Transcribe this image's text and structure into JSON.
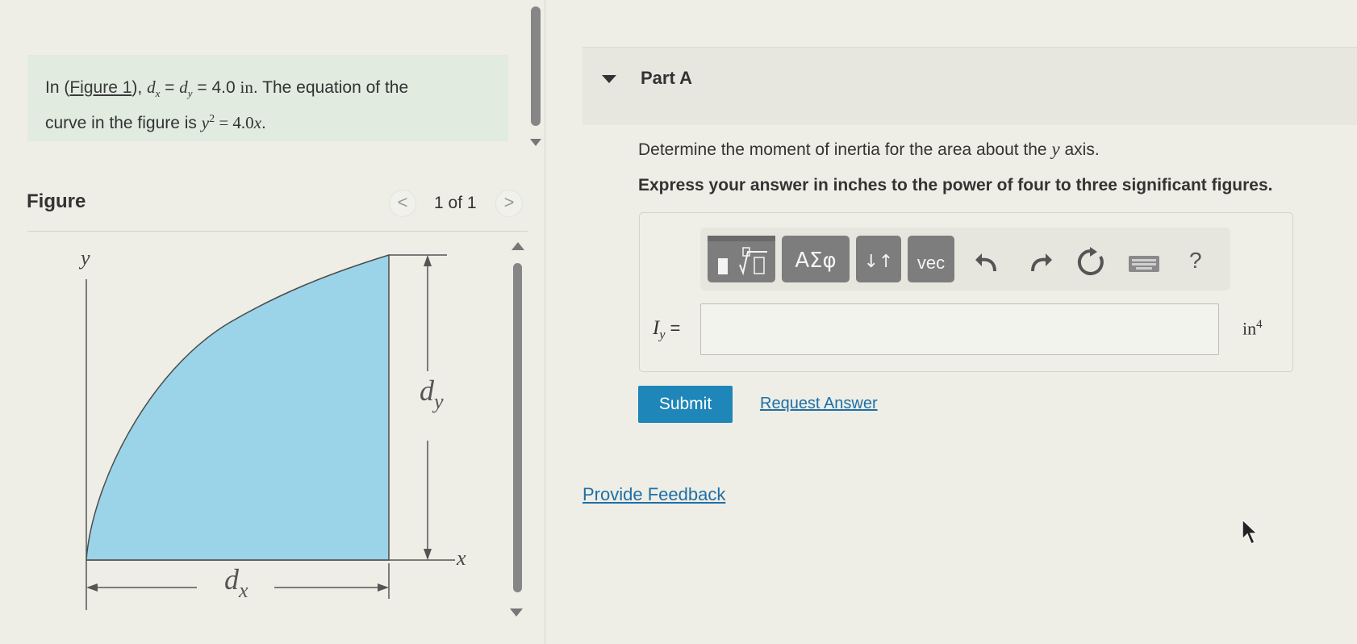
{
  "problem": {
    "prefix": "In (",
    "figure_link": "Figure 1",
    "after_link": "), ",
    "dx_sym": "d",
    "dx_sub": "x",
    "eq1": " = ",
    "dy_sym": "d",
    "dy_sub": "y",
    "eq2": " = 4.0 ",
    "unit": "in",
    "rest1": ". The equation of the",
    "line2_text": "curve in the figure is ",
    "curve_y": "y",
    "curve_exp": "2",
    "curve_eq": " = 4.0",
    "curve_x": "x",
    "curve_end": "."
  },
  "figure": {
    "title": "Figure",
    "counter": "1 of 1",
    "prev_glyph": "<",
    "next_glyph": ">",
    "labels": {
      "y_axis": "y",
      "x_axis": "x",
      "dy": "d",
      "dy_sub": "y",
      "dx": "d",
      "dx_sub": "x"
    },
    "fill_color": "#9bd4e8"
  },
  "part_a": {
    "title": "Part A",
    "question_prefix": "Determine the moment of inertia for the area about the ",
    "question_var": "y",
    "question_suffix": " axis.",
    "instruction": "Express your answer in inches to the power of four to three significant figures."
  },
  "toolbar": {
    "greek_label": "ΑΣφ",
    "arrows_label": "↓↑",
    "vec_label": "vec",
    "help_label": "?",
    "icons": [
      "templates-icon",
      "greek-icon",
      "subscript-arrows-icon",
      "vector-icon",
      "undo-icon",
      "redo-icon",
      "reset-icon",
      "keyboard-icon",
      "help-icon"
    ]
  },
  "answer": {
    "var": "I",
    "var_sub": "y",
    "equals": " =",
    "value": "",
    "unit": "in",
    "unit_exp": "4"
  },
  "actions": {
    "submit": "Submit",
    "request": "Request Answer",
    "feedback": "Provide Feedback"
  },
  "colors": {
    "submit": "#1e86b8",
    "link": "#1f6fa6",
    "toolbar_button": "#7d7d7d",
    "problem_box": "#e1ebe0"
  }
}
